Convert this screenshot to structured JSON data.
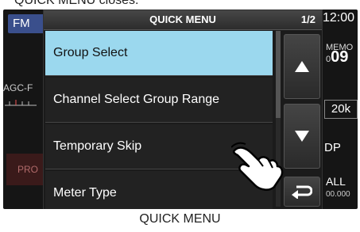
{
  "caption_top": "QUICK MENU closes.",
  "background": {
    "mode": "FM",
    "agc": "AGC-F",
    "clock": "12:00",
    "memo_label": "MEMO",
    "memo_value_prefix": "0",
    "memo_value": "09",
    "step": "20k",
    "dp": "DP",
    "pro": "PRO",
    "all_label": "ALL",
    "all_value": "00.000"
  },
  "dialog": {
    "title": "QUICK MENU",
    "page": "1/2",
    "items": [
      {
        "label": "Group Select",
        "selected": true
      },
      {
        "label": "Channel Select Group Range",
        "selected": false
      },
      {
        "label": "Temporary Skip",
        "selected": false
      },
      {
        "label": "Meter Type",
        "selected": false
      }
    ],
    "buttons": {
      "up": "up-arrow-icon",
      "down": "down-arrow-icon",
      "back": "return-icon"
    }
  },
  "caption_bottom": "QUICK MENU",
  "colors": {
    "selected_item": "#9bd8ee",
    "screen_bg": "#151515"
  }
}
